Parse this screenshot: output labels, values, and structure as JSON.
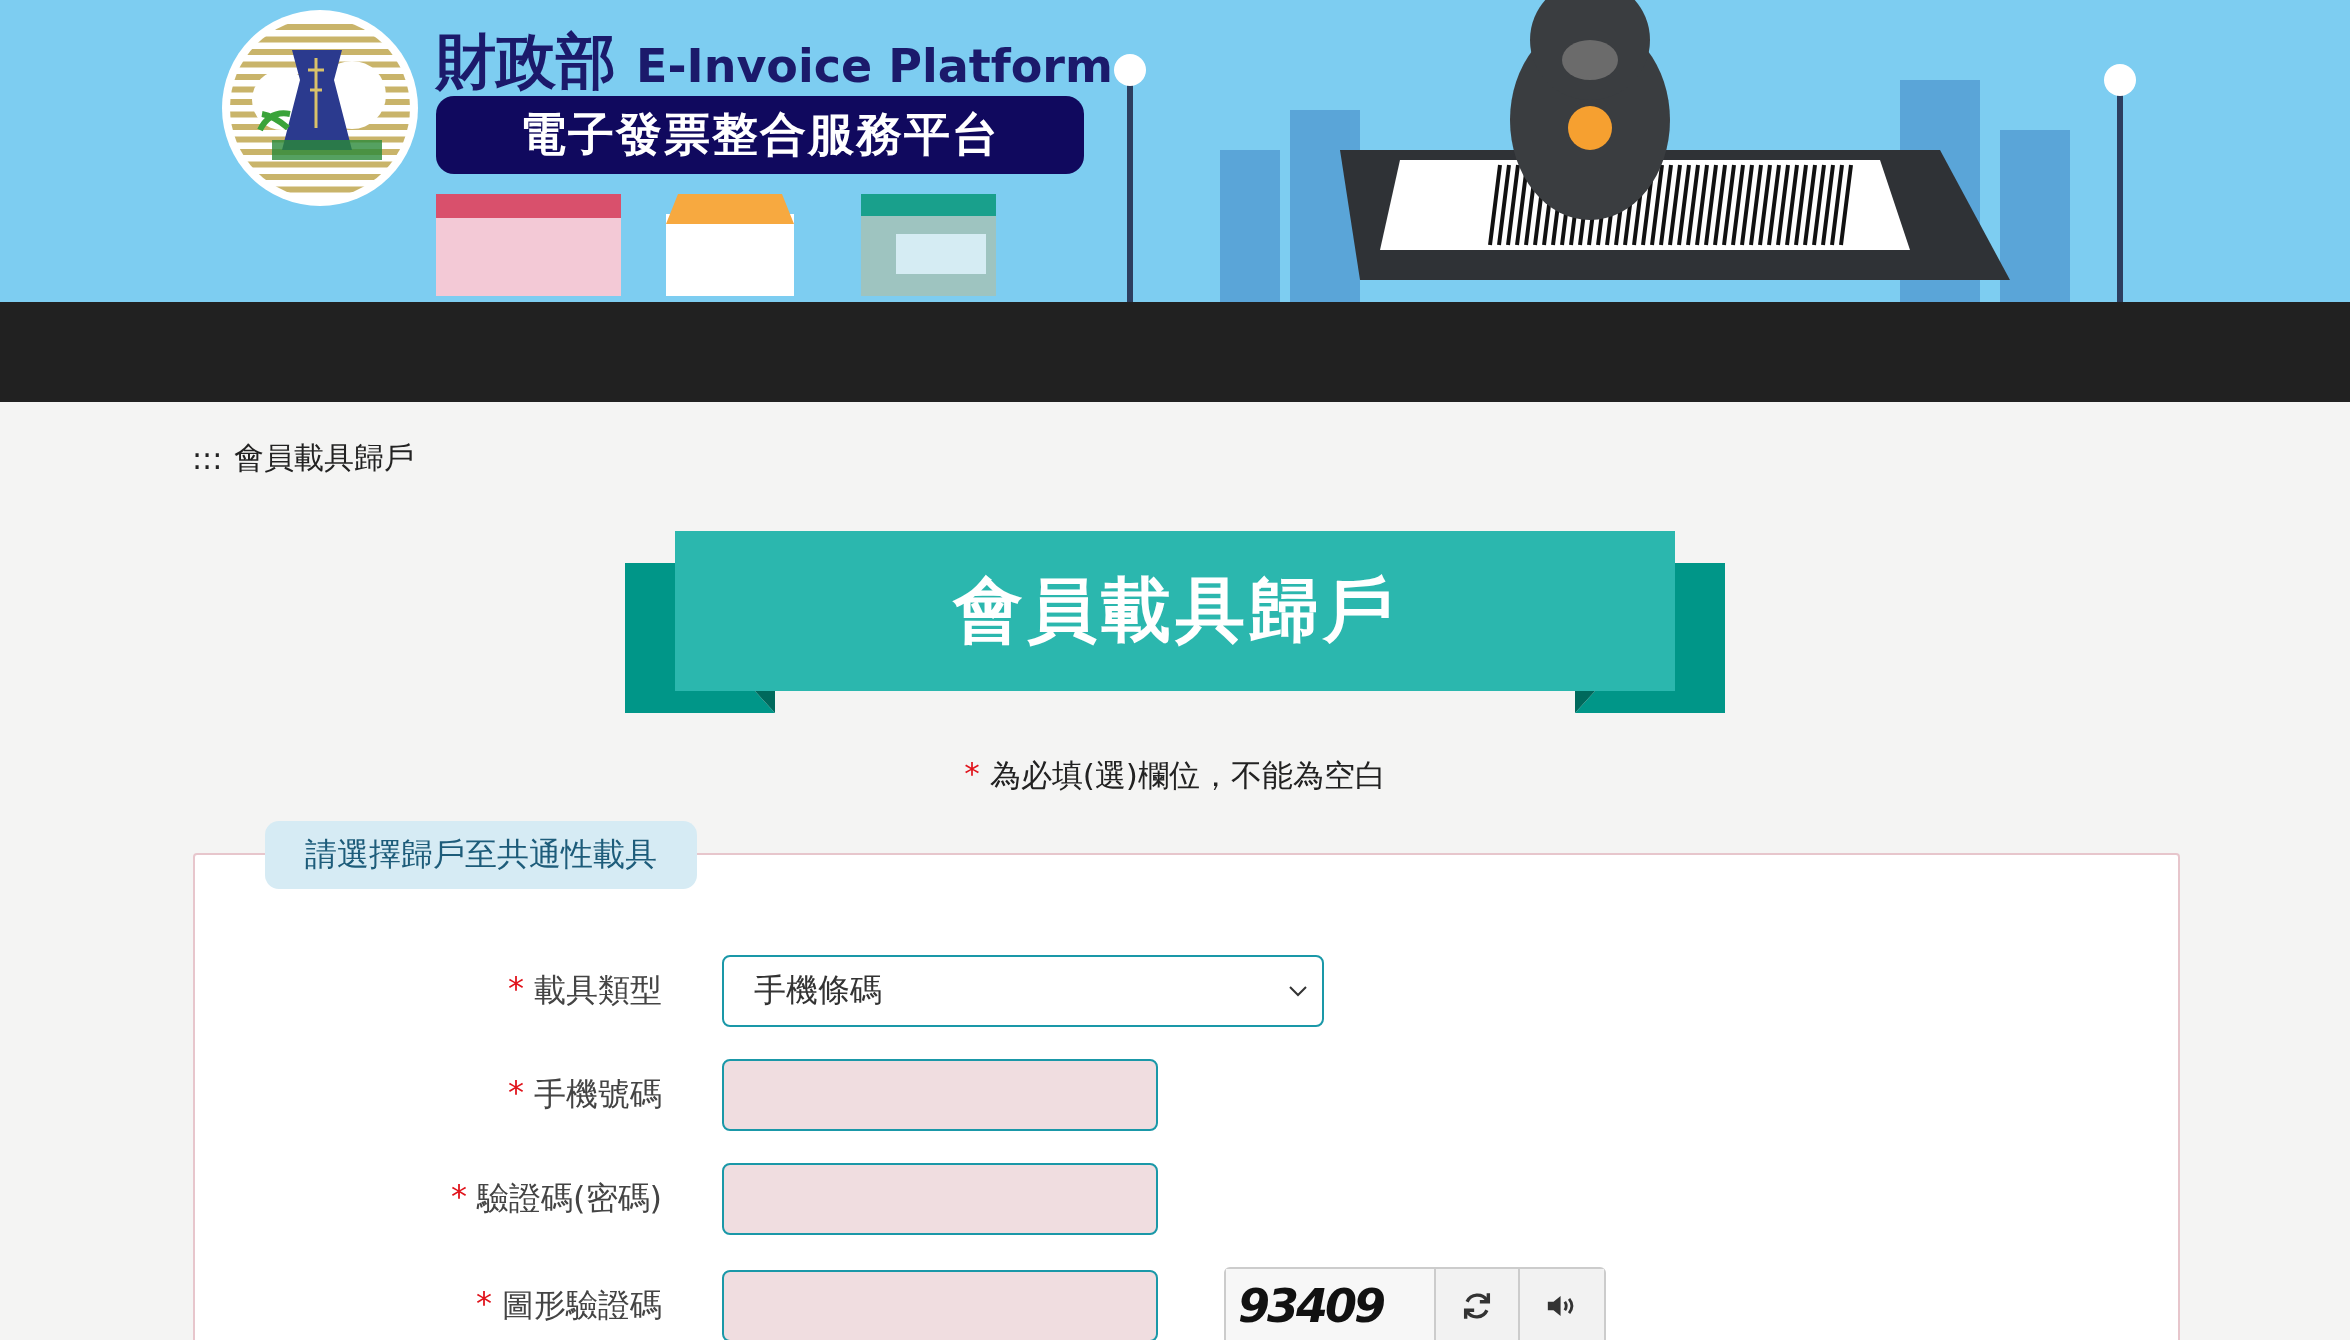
{
  "header": {
    "ministry": "財政部",
    "platform_en": "E-Invoice Platform",
    "platform_zh": "電子發票整合服務平台"
  },
  "breadcrumb": {
    "marker": ":::",
    "current": "會員載具歸戶"
  },
  "page_title": "會員載具歸戶",
  "required_note": {
    "mark": "*",
    "text": "為必填(選)欄位，不能為空白"
  },
  "form": {
    "legend": "請選擇歸戶至共通性載具",
    "fields": [
      {
        "kind": "select",
        "mark": "*",
        "label": "載具類型",
        "value": "手機條碼"
      },
      {
        "kind": "text",
        "mark": "*",
        "label": "手機號碼"
      },
      {
        "kind": "text",
        "mark": "*",
        "label": "驗證碼(密碼)"
      },
      {
        "kind": "captcha",
        "mark": "*",
        "label": "圖形驗證碼",
        "captcha": "93409"
      }
    ]
  }
}
